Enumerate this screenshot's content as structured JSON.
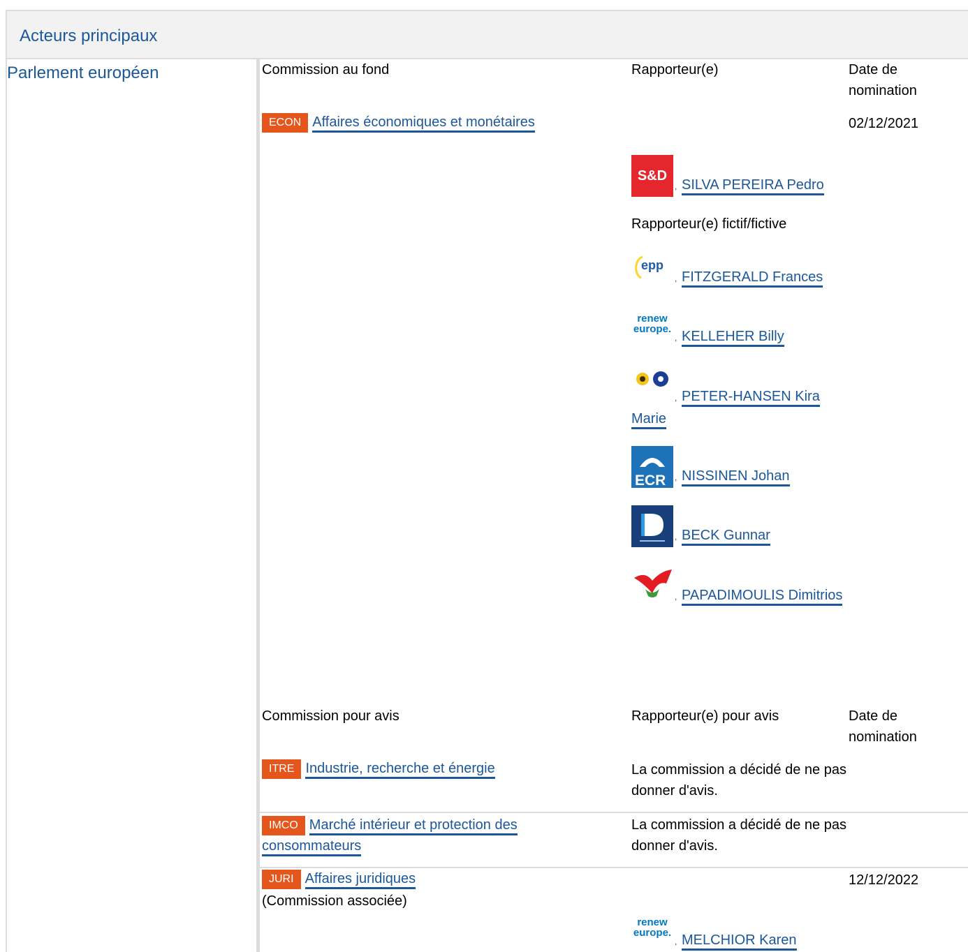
{
  "header": {
    "title": "Acteurs principaux"
  },
  "institution": {
    "name": "Parlement européen"
  },
  "lead": {
    "col_committee": "Commission au fond",
    "col_rapporteur": "Rapporteur(e)",
    "col_date": "Date de nomination",
    "committee_code": "ECON",
    "committee_name": "Affaires économiques et monétaires",
    "date": "02/12/2021",
    "rapporteur": {
      "group": "S&D",
      "name": "SILVA PEREIRA Pedro"
    },
    "shadow_label": "Rapporteur(e) fictif/fictive",
    "shadows": [
      {
        "group": "epp",
        "name": "FITZGERALD Frances"
      },
      {
        "group": "renew europe.",
        "name": "KELLEHER Billy"
      },
      {
        "group": "greens",
        "name": "PETER-HANSEN Kira Marie"
      },
      {
        "group": "ECR",
        "name": "NISSINEN Johan"
      },
      {
        "group": "ID",
        "name": "BECK Gunnar"
      },
      {
        "group": "left",
        "name": "PAPADIMOULIS Dimitrios"
      }
    ]
  },
  "opinion": {
    "col_committee": "Commission pour avis",
    "col_rapporteur": "Rapporteur(e) pour avis",
    "col_date": "Date de nomination",
    "rows": [
      {
        "code": "ITRE",
        "name": "Industrie, recherche et énergie",
        "note": "La commission a décidé de ne pas donner d'avis.",
        "date": ""
      },
      {
        "code": "IMCO",
        "name": "Marché intérieur et protection des consommateurs",
        "note": "La commission a décidé de ne pas donner d'avis.",
        "date": ""
      },
      {
        "code": "JURI",
        "name": "Affaires juridiques",
        "extra": "(Commission associée)",
        "date": "12/12/2022",
        "rapporteur": {
          "group": "renew europe.",
          "name": "MELCHIOR Karen"
        }
      }
    ]
  },
  "colors": {
    "link": "#1c5799",
    "badge": "#e4561b",
    "border": "#dcdcdc"
  }
}
